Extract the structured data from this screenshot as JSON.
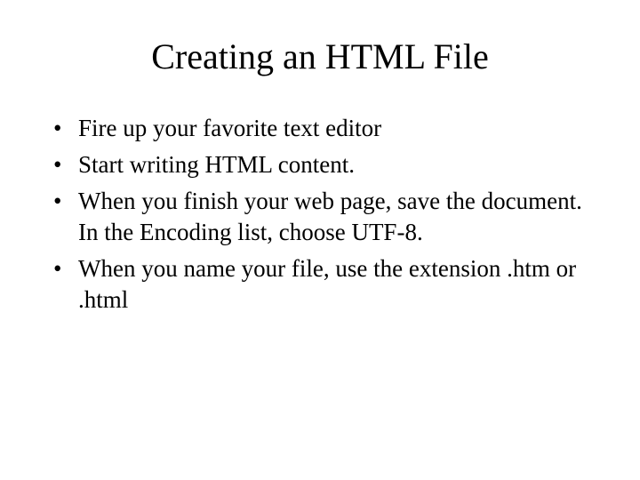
{
  "slide": {
    "title": "Creating an HTML File",
    "bullets": [
      "Fire up your favorite text editor",
      "Start writing HTML content.",
      "When you finish your web page, save the document. In the Encoding list, choose UTF-8.",
      "When you name your file, use the extension .htm or .html"
    ]
  }
}
